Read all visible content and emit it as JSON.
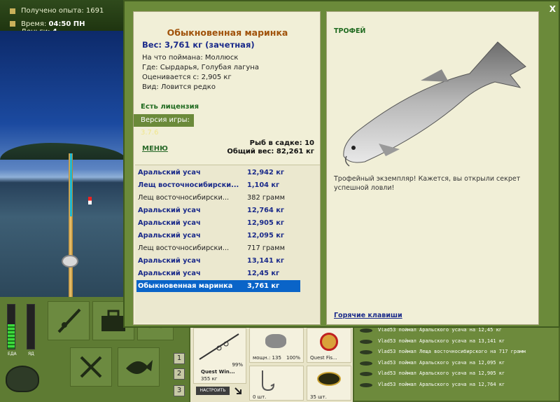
{
  "hud": {
    "experience": "Получено опыта: 1691",
    "time_label": "Время:",
    "time_value": "04:50 ПН",
    "money_label": "Деньги:",
    "money_value": "4",
    "food_label": "ЕДА",
    "poison_label": "ЯД"
  },
  "dialog": {
    "close": "X",
    "fish_name": "Обыкновенная маринка",
    "weight": "Вес: 3,761 кг (зачетная)",
    "caught_on": "На что поймана: Моллюск",
    "where": "Где: Сырдарья, Голубая лагуна",
    "valued_from": "Оценивается с: 2,905 кг",
    "kind": "Вид: Ловится редко",
    "license": "Есть лицензия",
    "version_label": "Версия игры:",
    "version_value": "3.7.6",
    "menu": "МЕНЮ",
    "fish_in_net": "Рыб в садке: 10",
    "total_weight": "Общий вес: 82,261 кг",
    "catch_list": [
      {
        "name": "Аральский усач",
        "weight": "12,942 кг",
        "style": "trophy"
      },
      {
        "name": "Лещ восточносибирски...",
        "weight": "1,104 кг",
        "style": "trophy"
      },
      {
        "name": "Лещ восточносибирски...",
        "weight": "382 грамм",
        "style": "plain"
      },
      {
        "name": "Аральский усач",
        "weight": "12,764 кг",
        "style": "trophy"
      },
      {
        "name": "Аральский усач",
        "weight": "12,905 кг",
        "style": "trophy"
      },
      {
        "name": "Аральский усач",
        "weight": "12,095 кг",
        "style": "trophy"
      },
      {
        "name": "Лещ восточносибирски...",
        "weight": "717 грамм",
        "style": "plain"
      },
      {
        "name": "Аральский усач",
        "weight": "13,141 кг",
        "style": "trophy"
      },
      {
        "name": "Аральский усач",
        "weight": "12,45 кг",
        "style": "trophy"
      },
      {
        "name": "Обыкновенная маринка",
        "weight": "3,761 кг",
        "style": "selected"
      }
    ],
    "trophy_label": "ТРОФЕЙ",
    "trophy_text": "Трофейный экземпляр! Кажется, вы открыли секрет успешной ловли!",
    "hotkeys": "Горячие клавиши"
  },
  "tackle": {
    "rod_name": "Quest Win...",
    "rod_weight": "355 кг",
    "rod_percent": "99%",
    "reel_power": "мощн.: 135",
    "reel_percent": "100%",
    "line_name": "Quest Fis...",
    "hooks_count": "0 шт.",
    "bait_count": "35 шт.",
    "setup_button": "НАСТРОИТЬ"
  },
  "slots": [
    "1",
    "2",
    "3"
  ],
  "chat": [
    "Vlad53 поймал Аральского усача на 12,45 кг",
    "Vlad53 поймал Аральского усача на 13,141 кг",
    "Vlad53 поймал Леща восточносибирского на 717 грамм",
    "Vlad53 поймал Аральского усача на 12,095 кг",
    "Vlad53 поймал Аральского усача на 12,905 кг",
    "Vlad53 поймал Аральского усача на 12,764 кг"
  ],
  "gauges": {
    "food_level": 0.55,
    "poison_level": 0.0
  }
}
